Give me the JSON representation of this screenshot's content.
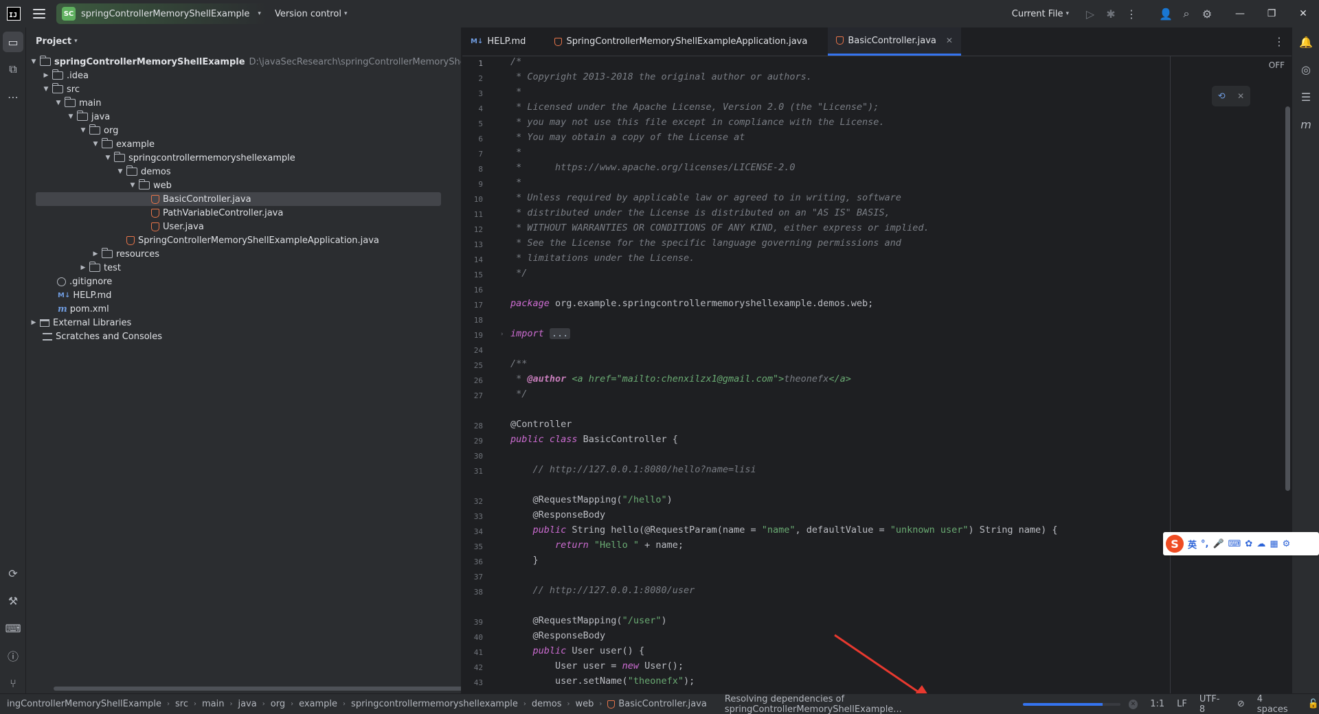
{
  "titlebar": {
    "app_icon_text": "IJ",
    "project_badge": "SC",
    "project_name": "springControllerMemoryShellExample",
    "version_control": "Version control",
    "run_config": "Current File"
  },
  "project_panel": {
    "title": "Project",
    "root_path": "D:\\javaSecResearch\\springControllerMemoryShellExamp",
    "items": [
      {
        "label": "springControllerMemoryShellExample"
      },
      {
        "label": ".idea"
      },
      {
        "label": "src"
      },
      {
        "label": "main"
      },
      {
        "label": "java"
      },
      {
        "label": "org"
      },
      {
        "label": "example"
      },
      {
        "label": "springcontrollermemoryshellexample"
      },
      {
        "label": "demos"
      },
      {
        "label": "web"
      },
      {
        "label": "BasicController.java"
      },
      {
        "label": "PathVariableController.java"
      },
      {
        "label": "User.java"
      },
      {
        "label": "SpringControllerMemoryShellExampleApplication.java"
      },
      {
        "label": "resources"
      },
      {
        "label": "test"
      },
      {
        "label": ".gitignore"
      },
      {
        "label": "HELP.md"
      },
      {
        "label": "pom.xml"
      },
      {
        "label": "External Libraries"
      },
      {
        "label": "Scratches and Consoles"
      }
    ]
  },
  "editor": {
    "tabs": [
      {
        "label": "HELP.md",
        "md_icon": "M↓"
      },
      {
        "label": "SpringControllerMemoryShellExampleApplication.java"
      },
      {
        "label": "BasicController.java"
      }
    ],
    "off_label": "OFF",
    "line_numbers": [
      "1",
      "2",
      "3",
      "4",
      "5",
      "6",
      "7",
      "8",
      "9",
      "10",
      "11",
      "12",
      "13",
      "14",
      "15",
      "16",
      "17",
      "18",
      "19",
      "24",
      "25",
      "26",
      "27",
      "28",
      "29",
      "30",
      "31",
      "32",
      "33",
      "34",
      "35",
      "36",
      "37",
      "38",
      "39",
      "40",
      "41",
      "42",
      "43"
    ],
    "lines": {
      "l1": "/*",
      "l2": " * Copyright 2013-2018 the original author or authors.",
      "l3": " *",
      "l4": " * Licensed under the Apache License, Version 2.0 (the \"License\");",
      "l5": " * you may not use this file except in compliance with the License.",
      "l6": " * You may obtain a copy of the License at",
      "l7": " *",
      "l8": " *      https://www.apache.org/licenses/LICENSE-2.0",
      "l9": " *",
      "l10": " * Unless required by applicable law or agreed to in writing, software",
      "l11": " * distributed under the License is distributed on an \"AS IS\" BASIS,",
      "l12": " * WITHOUT WARRANTIES OR CONDITIONS OF ANY KIND, either express or implied.",
      "l13": " * See the License for the specific language governing permissions and",
      "l14": " * limitations under the License.",
      "l15": " */",
      "l17_kw": "package",
      "l17_rest": " org.example.springcontrollermemoryshellexample.demos.web;",
      "l19_kw": "import",
      "l19_fold": "...",
      "l25": "/**",
      "l26_pre": " * ",
      "l26_tag": "@author",
      "l26_html": " <a href=\"mailto:chenxilzx1@gmail.com\">",
      "l26_name": "theonefx",
      "l26_close": "</a>",
      "l27": " */",
      "l28": "@Controller",
      "l29_kw": "public class",
      "l29_rest": " BasicController {",
      "l31": "    // http://127.0.0.1:8080/hello?name=lisi",
      "l32_ann": "    @RequestMapping(",
      "l32_str": "\"/hello\"",
      "l32_end": ")",
      "l33": "    @ResponseBody",
      "l34_kw": "    public",
      "l34_a": " String hello(@RequestParam(name = ",
      "l34_s1": "\"name\"",
      "l34_b": ", defaultValue = ",
      "l34_s2": "\"unknown user\"",
      "l34_c": ") String name) {",
      "l35_kw": "        return",
      "l35_str": " \"Hello \"",
      "l35_rest": " + name;",
      "l36": "    }",
      "l38": "    // http://127.0.0.1:8080/user",
      "l39_ann": "    @RequestMapping(",
      "l39_str": "\"/user\"",
      "l39_end": ")",
      "l40": "    @ResponseBody",
      "l41_kw": "    public",
      "l41_rest": " User user() {",
      "l42_a": "        User user = ",
      "l42_kw": "new",
      "l42_b": " User();",
      "l43_a": "        user.setName(",
      "l43_str": "\"theonefx\"",
      "l43_b": ");"
    }
  },
  "ime": {
    "logo": "S",
    "lang": "英",
    "punct": "°,"
  },
  "statusbar": {
    "breadcrumbs": [
      "ingControllerMemoryShellExample",
      "src",
      "main",
      "java",
      "org",
      "example",
      "springcontrollermemoryshellexample",
      "demos",
      "web"
    ],
    "file": "BasicController.java",
    "progress_text": "Resolving dependencies of springControllerMemoryShellExample...",
    "progress_value": 0.82,
    "position": "1:1",
    "line_sep": "LF",
    "encoding": "UTF-8",
    "indent": "4 spaces"
  },
  "colors": {
    "accent": "#3574f0",
    "annotation_arrow": "#e8392f"
  }
}
